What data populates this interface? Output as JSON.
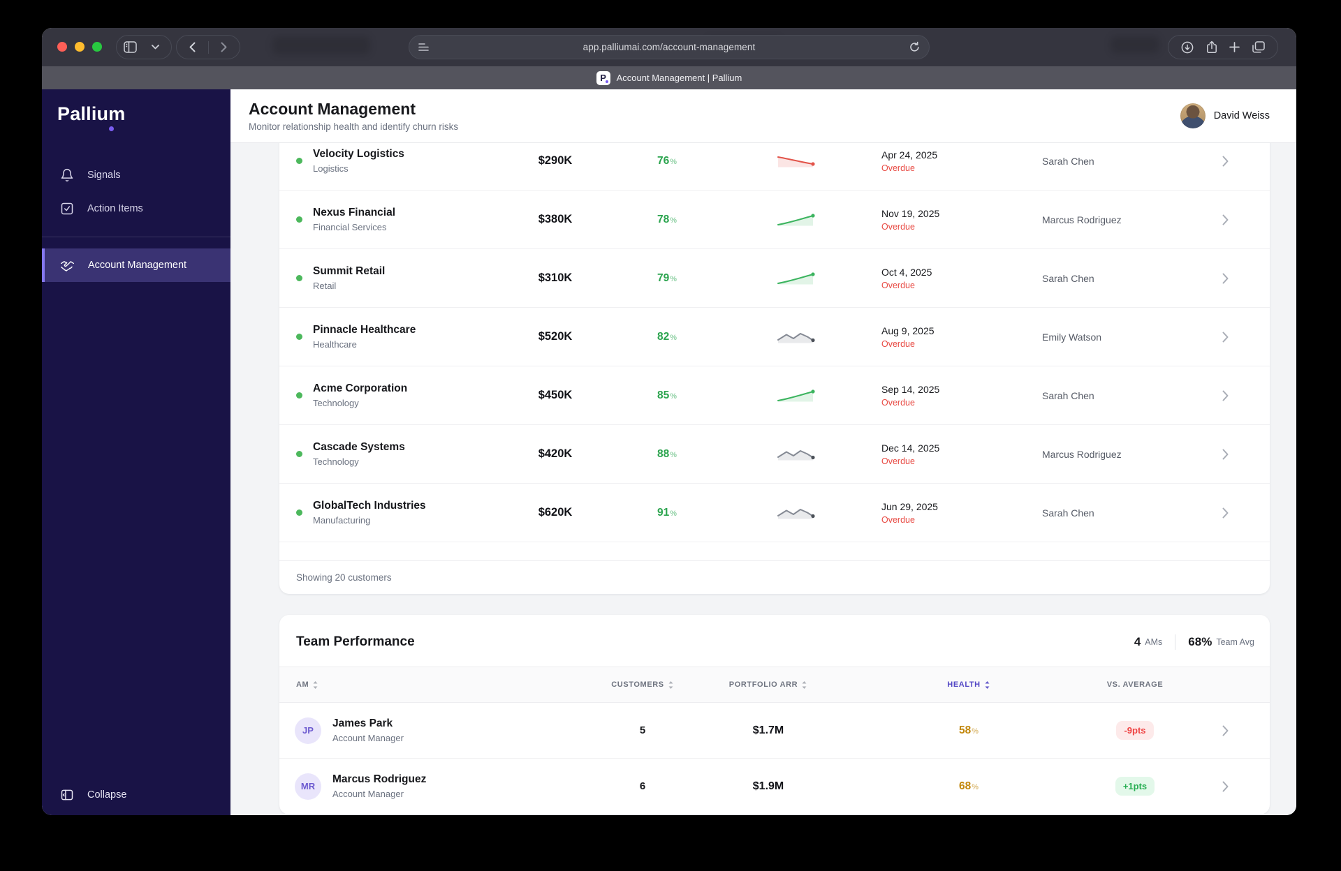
{
  "browser": {
    "url": "app.palliumai.com/account-management",
    "tab_title": "Account Management | Pallium",
    "favicon_letter": "P",
    "icons": [
      "close",
      "minimize",
      "zoom",
      "sidebar-toggle",
      "chevron-down",
      "back",
      "forward",
      "reader",
      "refresh",
      "download",
      "share",
      "new-tab",
      "tab-overview"
    ]
  },
  "sidebar": {
    "logo": "Pallium",
    "items": [
      {
        "label": "Signals",
        "icon": "bell-icon",
        "active": false
      },
      {
        "label": "Action Items",
        "icon": "check-square-icon",
        "active": false
      },
      {
        "label": "Account Management",
        "icon": "handshake-icon",
        "active": true
      }
    ],
    "collapse_label": "Collapse"
  },
  "header": {
    "title": "Account Management",
    "subtitle": "Monitor relationship health and identify churn risks",
    "user": "David Weiss"
  },
  "ui": {
    "percent": "%"
  },
  "colors": {
    "accent": "#7a5cf0",
    "green": "#3cb45f",
    "red": "#e84b44",
    "amber": "#c2870c",
    "sidebar": "#191346"
  },
  "customers": {
    "rows": [
      {
        "name": "Velocity Logistics",
        "industry": "Logistics",
        "arr": "$290K",
        "health": "76",
        "trend": "declining",
        "spark_class": "spark down",
        "renewal_date": "Apr 24, 2025",
        "renewal_status": "Overdue",
        "owner": "Sarah Chen"
      },
      {
        "name": "Nexus Financial",
        "industry": "Financial Services",
        "arr": "$380K",
        "health": "78",
        "trend": "improving",
        "spark_class": "spark up",
        "renewal_date": "Nov 19, 2025",
        "renewal_status": "Overdue",
        "owner": "Marcus Rodriguez"
      },
      {
        "name": "Summit Retail",
        "industry": "Retail",
        "arr": "$310K",
        "health": "79",
        "trend": "improving",
        "spark_class": "spark up",
        "renewal_date": "Oct 4, 2025",
        "renewal_status": "Overdue",
        "owner": "Sarah Chen"
      },
      {
        "name": "Pinnacle Healthcare",
        "industry": "Healthcare",
        "arr": "$520K",
        "health": "82",
        "trend": "volatile",
        "spark_class": "spark flat",
        "renewal_date": "Aug 9, 2025",
        "renewal_status": "Overdue",
        "owner": "Emily Watson"
      },
      {
        "name": "Acme Corporation",
        "industry": "Technology",
        "arr": "$450K",
        "health": "85",
        "trend": "improving",
        "spark_class": "spark up",
        "renewal_date": "Sep 14, 2025",
        "renewal_status": "Overdue",
        "owner": "Sarah Chen"
      },
      {
        "name": "Cascade Systems",
        "industry": "Technology",
        "arr": "$420K",
        "health": "88",
        "trend": "volatile",
        "spark_class": "spark flat",
        "renewal_date": "Dec 14, 2025",
        "renewal_status": "Overdue",
        "owner": "Marcus Rodriguez"
      },
      {
        "name": "GlobalTech Industries",
        "industry": "Manufacturing",
        "arr": "$620K",
        "health": "91",
        "trend": "volatile",
        "spark_class": "spark flat",
        "renewal_date": "Jun 29, 2025",
        "renewal_status": "Overdue",
        "owner": "Sarah Chen"
      }
    ],
    "footer": "Showing 20 customers"
  },
  "team": {
    "title": "Team Performance",
    "stats": {
      "ams_value": "4",
      "ams_label": "AMs",
      "avg_value": "68%",
      "avg_label": "Team Avg"
    },
    "columns": [
      "AM",
      "CUSTOMERS",
      "PORTFOLIO ARR",
      "HEALTH",
      "VS. AVERAGE"
    ],
    "rows": [
      {
        "initials": "JP",
        "name": "James Park",
        "role": "Account Manager",
        "customers": "5",
        "arr": "$1.7M",
        "health": "58",
        "delta": "-9pts",
        "delta_class": "badge neg"
      },
      {
        "initials": "MR",
        "name": "Marcus Rodriguez",
        "role": "Account Manager",
        "customers": "6",
        "arr": "$1.9M",
        "health": "68",
        "delta": "+1pts",
        "delta_class": "badge pos"
      }
    ]
  }
}
